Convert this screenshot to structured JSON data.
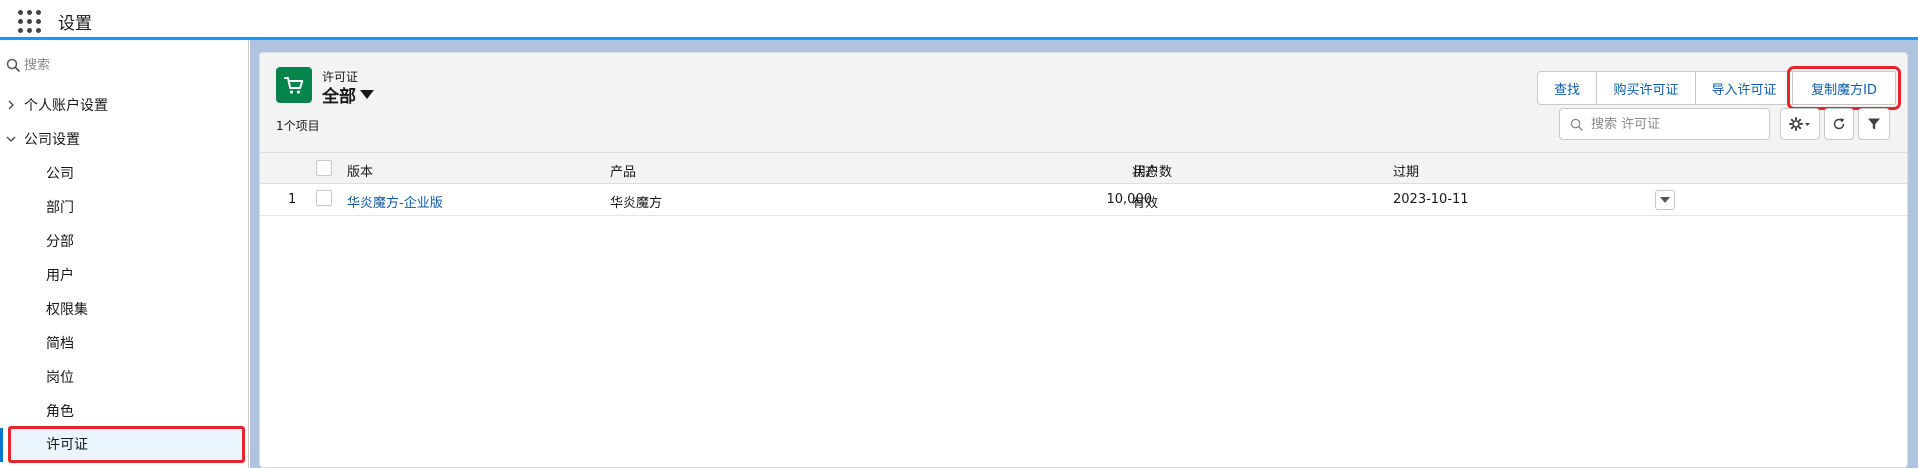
{
  "header": {
    "title": "设置"
  },
  "sidebar": {
    "search_placeholder": "搜索",
    "groups": [
      {
        "label": "个人账户设置",
        "expanded": false
      },
      {
        "label": "公司设置",
        "expanded": true
      }
    ],
    "children": [
      "公司",
      "部门",
      "分部",
      "用户",
      "权限集",
      "简档",
      "岗位",
      "角色"
    ],
    "selected": "许可证"
  },
  "list": {
    "object_label": "许可证",
    "view_name": "全部",
    "item_count": "1个项目",
    "buttons": {
      "find": "查找",
      "buy": "购买许可证",
      "import": "导入许可证",
      "copy_id": "复制魔方ID"
    },
    "search_placeholder": "搜索 许可证",
    "columns": {
      "edition": "版本",
      "product": "产品",
      "user_count": "用户数",
      "status": "状态",
      "expiry": "过期"
    },
    "rows": [
      {
        "num": "1",
        "edition": "华炎魔方-企业版",
        "product": "华炎魔方",
        "user_count": "10,000",
        "status": "有效",
        "expiry": "2023-10-11"
      }
    ]
  },
  "colors": {
    "accent": "#1b96ff",
    "object_icon": "#04844b",
    "link": "#0b5cab",
    "highlight_outline": "#e3262c",
    "main_background": "#b0c4df"
  },
  "icons": [
    "app-launcher-icon",
    "search-icon",
    "chevron-right-icon",
    "chevron-down-icon",
    "cart-icon",
    "gear-icon",
    "refresh-icon",
    "filter-icon"
  ]
}
